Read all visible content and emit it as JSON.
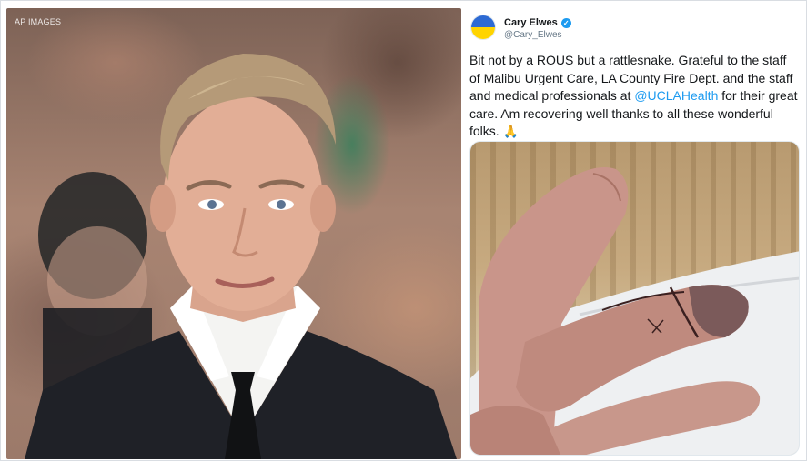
{
  "photo": {
    "credit": "AP IMAGES"
  },
  "tweet": {
    "display_name": "Cary Elwes",
    "handle": "@Cary_Elwes",
    "verified_icon": "verified-badge-icon",
    "text_parts": {
      "before_mention": "Bit not by a ROUS but a rattlesnake. Grateful to the staff of Malibu Urgent Care, LA County Fire Dept. and the staff and medical professionals at ",
      "mention": "@UCLAHealth",
      "after_mention": " for their great care. Am recovering well thanks to all these wonderful folks. ",
      "emoji": "🙏"
    },
    "image_description_icon": "swollen-finger-photo"
  },
  "colors": {
    "link": "#1d9bf0",
    "avatar_top": "#2d6ad3",
    "avatar_bottom": "#ffd400"
  }
}
